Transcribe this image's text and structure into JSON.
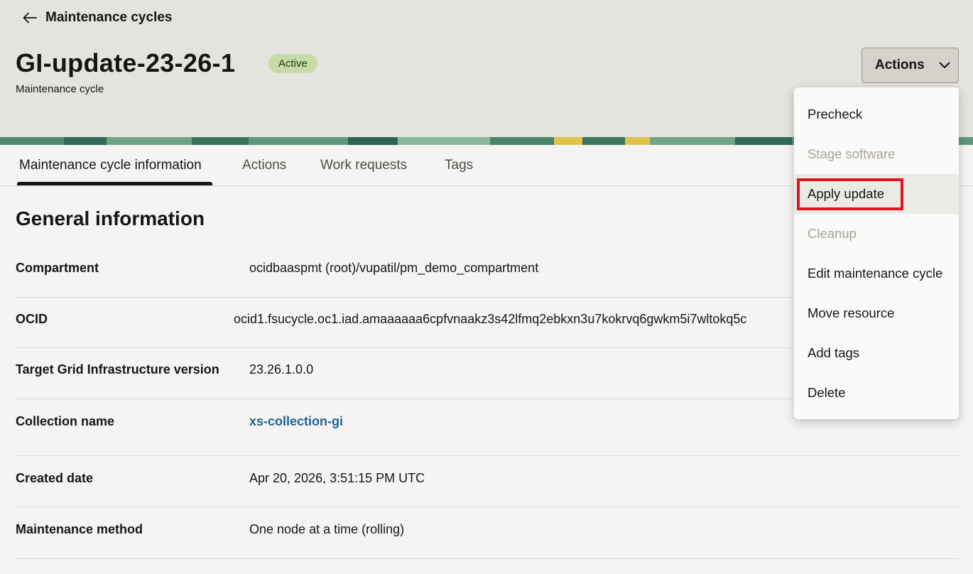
{
  "header": {
    "back_label": "Maintenance cycles",
    "title": "GI-update-23-26-1",
    "status": "Active",
    "subtitle": "Maintenance cycle",
    "actions_label": "Actions"
  },
  "tabs": [
    {
      "label": "Maintenance cycle information",
      "active": true
    },
    {
      "label": "Actions",
      "active": false
    },
    {
      "label": "Work requests",
      "active": false
    },
    {
      "label": "Tags",
      "active": false
    }
  ],
  "section_title": "General information",
  "details": [
    {
      "label": "Compartment",
      "value": "ocidbaaspmt (root)/vupatil/pm_demo_compartment"
    },
    {
      "label": "OCID",
      "value": "ocid1.fsucycle.oc1.iad.amaaaaaa6cpfvnaakz3s42lfmq2ebkxn3u7kokrvq6gwkm5i7wltokq5c"
    },
    {
      "label": "Target Grid Infrastructure version",
      "value": "23.26.1.0.0"
    },
    {
      "label": "Collection name",
      "value": "xs-collection-gi"
    },
    {
      "label": "Created date",
      "value": "Apr 20, 2026, 3:51:15 PM UTC"
    },
    {
      "label": "Maintenance method",
      "value": "One node at a time (rolling)"
    }
  ],
  "actions_menu": {
    "items": [
      {
        "label": "Precheck",
        "disabled": false
      },
      {
        "label": "Stage software",
        "disabled": true
      },
      {
        "label": "Apply update",
        "disabled": false,
        "highlighted": true
      },
      {
        "label": "Cleanup",
        "disabled": true
      },
      {
        "label": "Edit maintenance cycle",
        "disabled": false
      },
      {
        "label": "Move resource",
        "disabled": false
      },
      {
        "label": "Add tags",
        "disabled": false
      },
      {
        "label": "Delete",
        "disabled": false
      }
    ]
  },
  "colors": {
    "header_bg": "#e5e3df",
    "badge_bg": "#c6dba7",
    "link": "#1e6592",
    "highlight": "#e0141e"
  },
  "icons": {
    "back": "arrow-left-icon",
    "actions": "chevron-down-icon"
  }
}
